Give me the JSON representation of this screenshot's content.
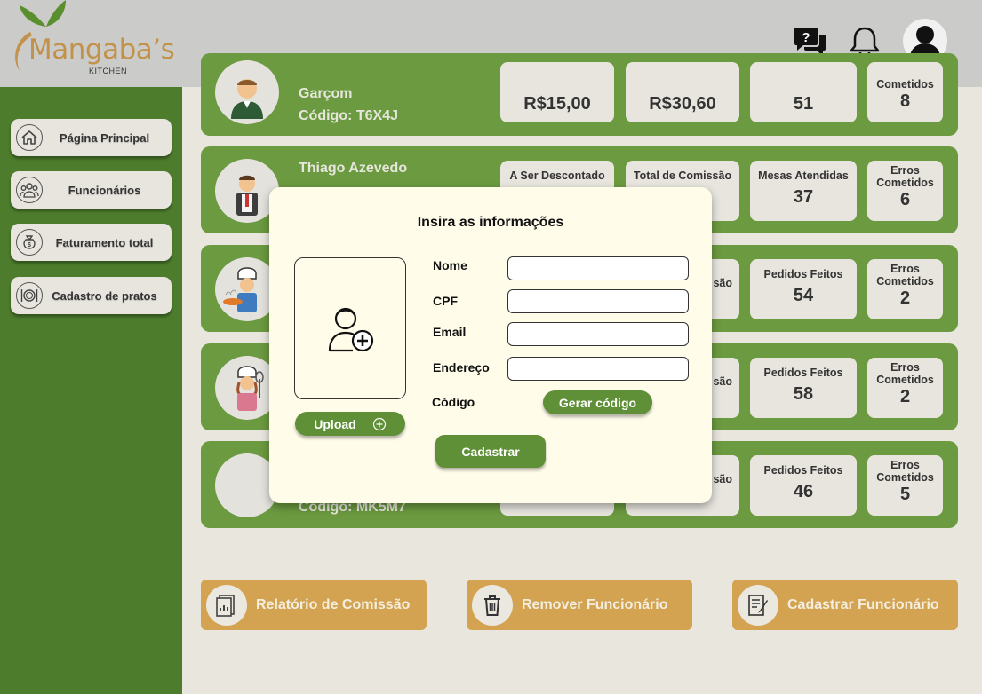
{
  "brand": {
    "name": "Mangaba’s",
    "subtitle": "KITCHEN",
    "accent": "#c3924a",
    "primary_green": "#4d7d2c"
  },
  "header": {
    "icons": [
      "help-chat-icon",
      "bell-icon",
      "user-avatar-icon"
    ]
  },
  "sidebar": {
    "items": [
      {
        "label": "Página Principal",
        "icon": "home-icon"
      },
      {
        "label": "Funcionários",
        "icon": "people-icon"
      },
      {
        "label": "Faturamento total",
        "icon": "money-bag-icon"
      },
      {
        "label": "Cadastro de pratos",
        "icon": "plate-icon"
      }
    ]
  },
  "employees": [
    {
      "name": "",
      "role": "Garçom",
      "code": "Código: T6X4J",
      "stats": [
        {
          "label": "",
          "value": "R$15,00"
        },
        {
          "label": "",
          "value": "R$30,60"
        },
        {
          "label": "",
          "value": "51"
        },
        {
          "label": "Cometidos",
          "value": "8"
        }
      ]
    },
    {
      "name": "Thiago Azevedo",
      "code": "",
      "stats": [
        {
          "label": "A Ser Descontado",
          "value": ""
        },
        {
          "label": "Total de Comissão",
          "value": ""
        },
        {
          "label": "Mesas Atendidas",
          "value": "37"
        },
        {
          "label": "Erros Cometidos",
          "value": "6"
        }
      ]
    },
    {
      "name": "",
      "code": "",
      "stats": [
        {
          "label": "",
          "value": ""
        },
        {
          "label": "são",
          "value": ""
        },
        {
          "label": "Pedidos Feitos",
          "value": "54"
        },
        {
          "label": "Erros Cometidos",
          "value": "2"
        }
      ]
    },
    {
      "name": "",
      "code": "",
      "stats": [
        {
          "label": "",
          "value": ""
        },
        {
          "label": "são",
          "value": ""
        },
        {
          "label": "Pedidos Feitos",
          "value": "58"
        },
        {
          "label": "Erros Cometidos",
          "value": "2"
        }
      ]
    },
    {
      "name": "",
      "code": "Código: MK5M7",
      "stats": [
        {
          "label": "",
          "value": ""
        },
        {
          "label": "são",
          "value": ""
        },
        {
          "label": "Pedidos Feitos",
          "value": "46"
        },
        {
          "label": "Erros Cometidos",
          "value": "5"
        }
      ]
    }
  ],
  "actions": [
    {
      "label": "Relatório de Comissão",
      "icon": "report-icon"
    },
    {
      "label": "Remover Funcionário",
      "icon": "trash-icon"
    },
    {
      "label": "Cadastrar Funcionário",
      "icon": "form-icon"
    }
  ],
  "modal": {
    "title": "Insira as informações",
    "upload_label": "Upload",
    "fields": [
      {
        "label": "Nome",
        "value": "",
        "placeholder": ""
      },
      {
        "label": "CPF",
        "value": "",
        "placeholder": ""
      },
      {
        "label": "Email",
        "value": "",
        "placeholder": ""
      },
      {
        "label": "Endereço",
        "value": "",
        "placeholder": ""
      }
    ],
    "code_label": "Código",
    "generate_label": "Gerar código",
    "submit_label": "Cadastrar"
  }
}
